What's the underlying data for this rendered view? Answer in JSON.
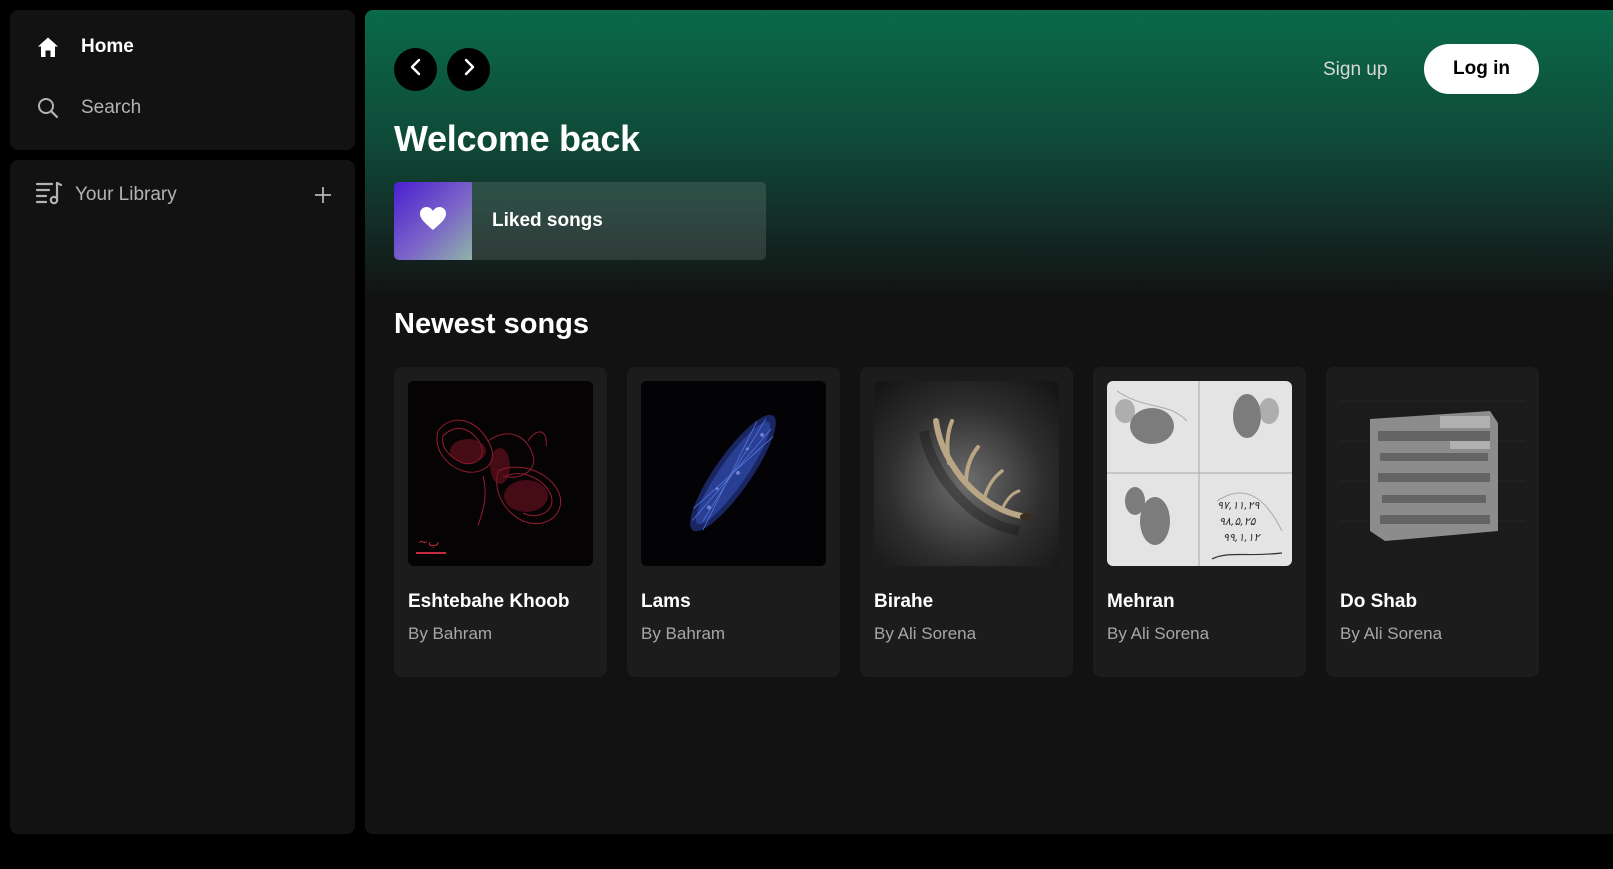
{
  "sidebar": {
    "nav": [
      {
        "label": "Home",
        "icon": "home-icon"
      },
      {
        "label": "Search",
        "icon": "search-icon"
      }
    ],
    "library": {
      "label": "Your Library",
      "icon": "library-icon",
      "add_icon": "plus-icon"
    }
  },
  "header": {
    "back_icon": "chevron-left-icon",
    "forward_icon": "chevron-right-icon",
    "signup_label": "Sign up",
    "login_label": "Log in"
  },
  "main": {
    "greeting": "Welcome back",
    "liked": {
      "label": "Liked songs",
      "icon": "heart-icon"
    },
    "newest": {
      "title": "Newest songs",
      "songs": [
        {
          "title": "Eshtebahe Khoob",
          "artist": "By Bahram"
        },
        {
          "title": "Lams",
          "artist": "By Bahram"
        },
        {
          "title": "Birahe",
          "artist": "By Ali Sorena"
        },
        {
          "title": "Mehran",
          "artist": "By Ali Sorena"
        },
        {
          "title": "Do Shab",
          "artist": "By Ali Sorena"
        }
      ]
    }
  },
  "colors": {
    "header_gradient_top": "#0a6a4a",
    "surface": "#121212",
    "card": "#1c1c1c",
    "liked_gradient": [
      "#4b1fd1",
      "#8fb4a8"
    ]
  }
}
